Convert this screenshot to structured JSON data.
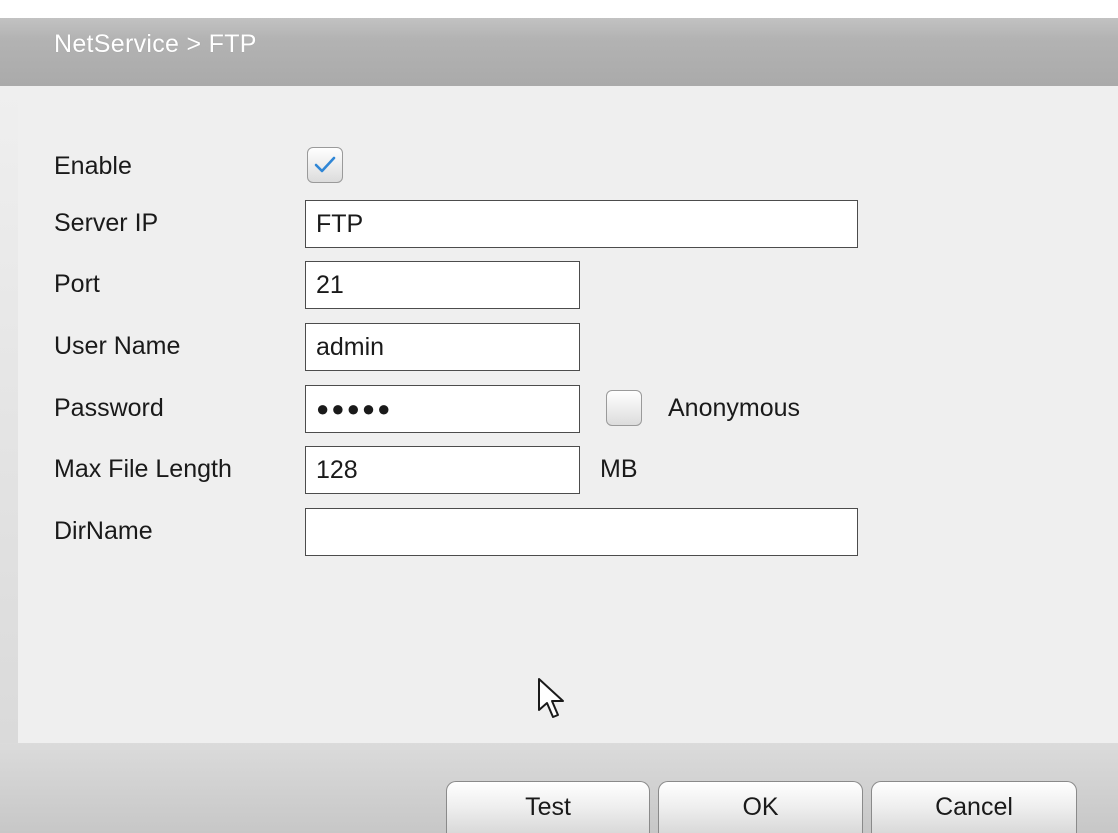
{
  "window": {
    "title": "NetService > FTP"
  },
  "form": {
    "enable": {
      "label": "Enable",
      "checked": true
    },
    "server_ip": {
      "label": "Server IP",
      "value": "FTP"
    },
    "port": {
      "label": "Port",
      "value": "21"
    },
    "user_name": {
      "label": "User Name",
      "value": "admin"
    },
    "password": {
      "label": "Password",
      "value": "●●●●●"
    },
    "anonymous": {
      "label": "Anonymous",
      "checked": false
    },
    "max_file_length": {
      "label": "Max File Length",
      "value": "128",
      "unit": "MB"
    },
    "dir_name": {
      "label": "DirName",
      "value": ""
    }
  },
  "buttons": {
    "test": "Test",
    "ok": "OK",
    "cancel": "Cancel"
  },
  "colors": {
    "check_blue": "#2f86d6",
    "title_text": "#ffffff"
  },
  "icons": {
    "cursor": "mouse-pointer-icon",
    "check": "checkmark-icon"
  }
}
